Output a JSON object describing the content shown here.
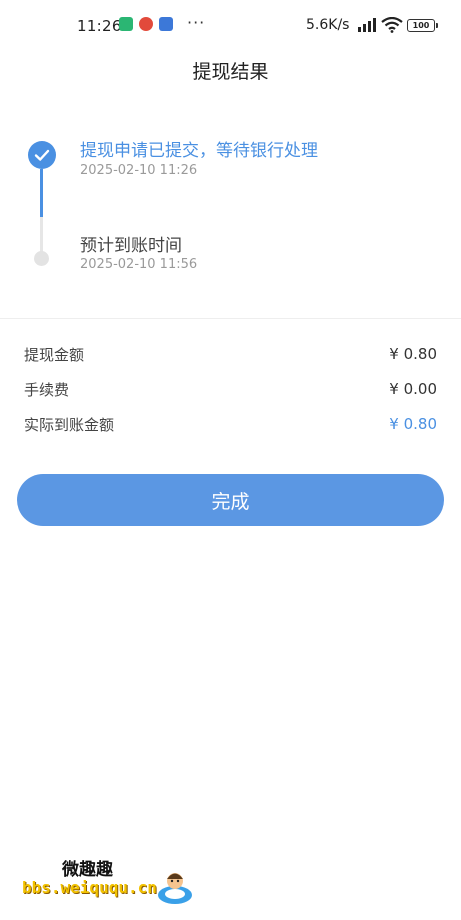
{
  "status_bar": {
    "time": "11:26",
    "dots": "···",
    "net_speed": "5.6K/s",
    "battery": "100",
    "app_colors": [
      "#2bb673",
      "#e24a3b",
      "#3c78d8"
    ]
  },
  "header": {
    "title": "提现结果"
  },
  "timeline": {
    "steps": [
      {
        "title": "提现申请已提交，等待银行处理",
        "time": "2025-02-10 11:26",
        "status": "done"
      },
      {
        "title": "预计到账时间",
        "time": "2025-02-10 11:56",
        "status": "pending"
      }
    ],
    "accent_color": "#4a90e2"
  },
  "amounts": {
    "rows": [
      {
        "label": "提现金额",
        "value": "¥ 0.80"
      },
      {
        "label": "手续费",
        "value": "¥ 0.00"
      },
      {
        "label": "实际到账金额",
        "value": "¥ 0.80"
      }
    ]
  },
  "actions": {
    "done_label": "完成",
    "button_color": "#5b97e3"
  },
  "watermark": {
    "brand": "微趣趣",
    "url": "bbs.weiququ.cn"
  },
  "icons": {
    "check": "check-icon",
    "wifi": "wifi-icon",
    "signal": "signal-icon",
    "battery": "battery-icon"
  }
}
